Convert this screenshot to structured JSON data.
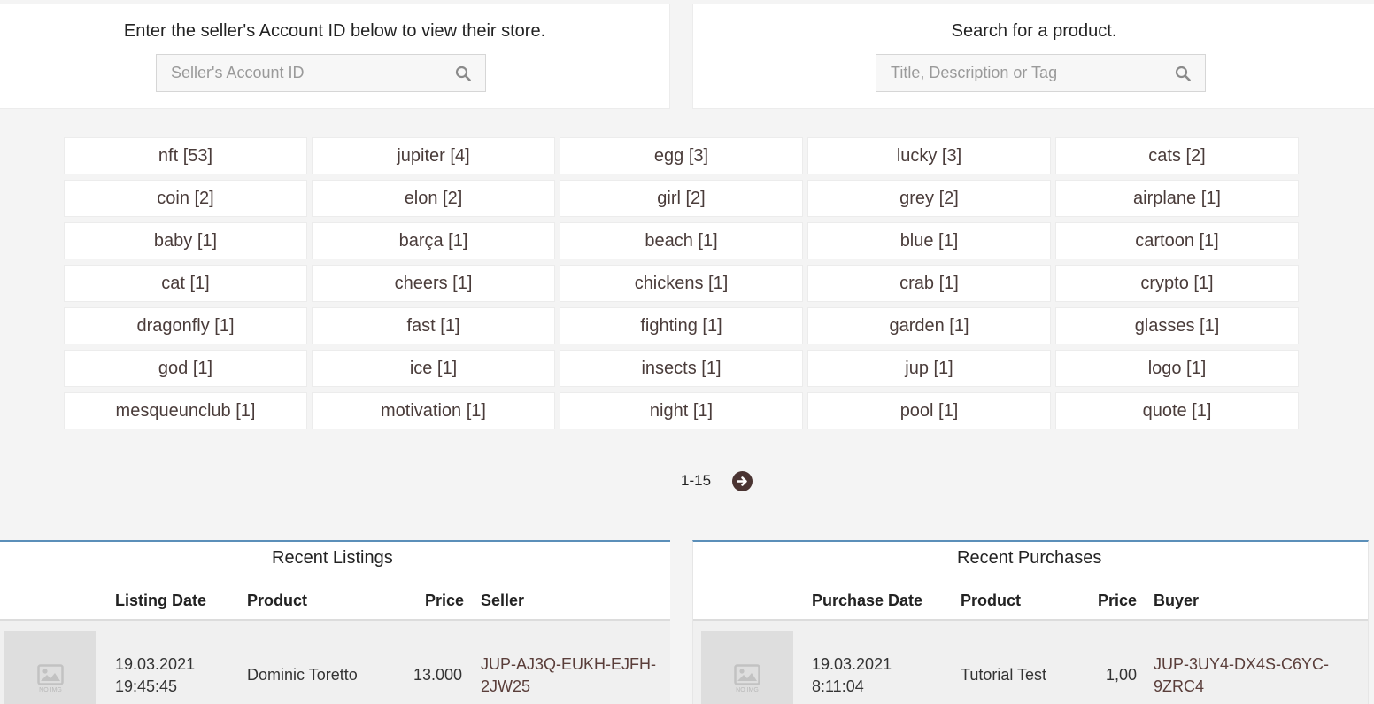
{
  "seller_search": {
    "title": "Enter the seller's Account ID below to view their store.",
    "placeholder": "Seller's Account ID",
    "value": ""
  },
  "product_search": {
    "title": "Search for a product.",
    "placeholder": "Title, Description or Tag",
    "value": ""
  },
  "tags": [
    "nft [53]",
    "jupiter [4]",
    "egg [3]",
    "lucky [3]",
    "cats [2]",
    "coin [2]",
    "elon [2]",
    "girl [2]",
    "grey [2]",
    "airplane [1]",
    "baby [1]",
    "barça [1]",
    "beach [1]",
    "blue [1]",
    "cartoon [1]",
    "cat [1]",
    "cheers [1]",
    "chickens [1]",
    "crab [1]",
    "crypto [1]",
    "dragonfly [1]",
    "fast [1]",
    "fighting [1]",
    "garden [1]",
    "glasses [1]",
    "god [1]",
    "ice [1]",
    "insects [1]",
    "jup [1]",
    "logo [1]",
    "mesqueunclub [1]",
    "motivation [1]",
    "night [1]",
    "pool [1]",
    "quote [1]"
  ],
  "pagination": {
    "range": "1-15",
    "next_icon": "arrow-right-circle-icon"
  },
  "recent_listings": {
    "title": "Recent Listings",
    "headers": {
      "date": "Listing Date",
      "product": "Product",
      "price": "Price",
      "party": "Seller"
    },
    "rows": [
      {
        "thumbnail_label": "NO IMG",
        "date": "19.03.2021",
        "time": "19:45:45",
        "product": "Dominic Toretto",
        "price": "13.000",
        "party_line1": "JUP-AJ3Q-EUKH-EJFH-",
        "party_line2": "2JW25"
      }
    ]
  },
  "recent_purchases": {
    "title": "Recent Purchases",
    "headers": {
      "date": "Purchase Date",
      "product": "Product",
      "price": "Price",
      "party": "Buyer"
    },
    "rows": [
      {
        "thumbnail_label": "NO IMG",
        "date": "19.03.2021",
        "time": "8:11:04",
        "product": "Tutorial Test",
        "price": "1,00",
        "party_line1": "JUP-3UY4-DX4S-C6YC-",
        "party_line2": "9ZRC4"
      }
    ]
  },
  "colors": {
    "accent_border": "#5b8fb9",
    "tag_text": "#4a3c3a",
    "next_button": "#4a3432",
    "link_text": "#5a3e3a"
  }
}
